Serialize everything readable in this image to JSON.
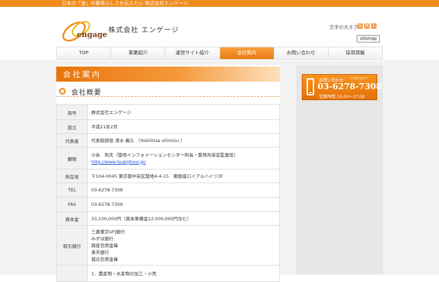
{
  "top_bar": {
    "tagline": "日本の「食」の素晴らしさを伝えたい 株式会社エンゲージ"
  },
  "header": {
    "logo_text": "engage",
    "company_name": "株式会社 エンゲージ",
    "font_size_label": "文字の大きさ",
    "font_sizes": [
      "S",
      "M",
      "L"
    ],
    "sitemap_label": "sitemap"
  },
  "nav": {
    "items": [
      {
        "label": "TOP"
      },
      {
        "label": "事業紹介"
      },
      {
        "label": "運営サイト紹介"
      },
      {
        "label": "会社案内",
        "active": true
      },
      {
        "label": "お問い合わせ"
      },
      {
        "label": "採用情報"
      }
    ]
  },
  "page": {
    "title": "会社案内",
    "section_title": "会社概要"
  },
  "info_table": {
    "rows": [
      {
        "label": "商号",
        "value": "株式会社エンゲージ"
      },
      {
        "label": "設立",
        "value": "平成21年2月"
      },
      {
        "label": "代表者",
        "value": "代表取締役 清水 義久 （Yoshihisa shimizu ）"
      },
      {
        "label": "顧問",
        "value": "小糸　則夫（築地インフォメーションセンター所長・築地共栄会監査役）",
        "link": "http://www.tsukijitour.jp/"
      },
      {
        "label": "所在地",
        "value": "〒104-0045 東京都中央区築地4-4-15　東銀座ロイアルハイツ3F"
      },
      {
        "label": "TEL",
        "value": "03-6278-7308"
      },
      {
        "label": "FAX",
        "value": "03-6278-7309"
      },
      {
        "label": "資本金",
        "value": "33,100,000円（資本準備金12,000,000円含む）"
      },
      {
        "label": "取引銀行",
        "lines": [
          "三菱東京UFJ銀行",
          "みずほ銀行",
          "興産信用金庫",
          "楽天銀行",
          "城北信用金庫"
        ]
      },
      {
        "label": "",
        "lines": [
          "1．農産物・水産物の加工・小売"
        ]
      }
    ]
  },
  "contact_box": {
    "label": "お問い合わせ",
    "tag": "CONTACT",
    "phone": "03-6278-7308",
    "hours": "営業時間 10:00～17:00"
  },
  "colors": {
    "accent": "#f08c1e",
    "link": "#1a4bd6"
  }
}
